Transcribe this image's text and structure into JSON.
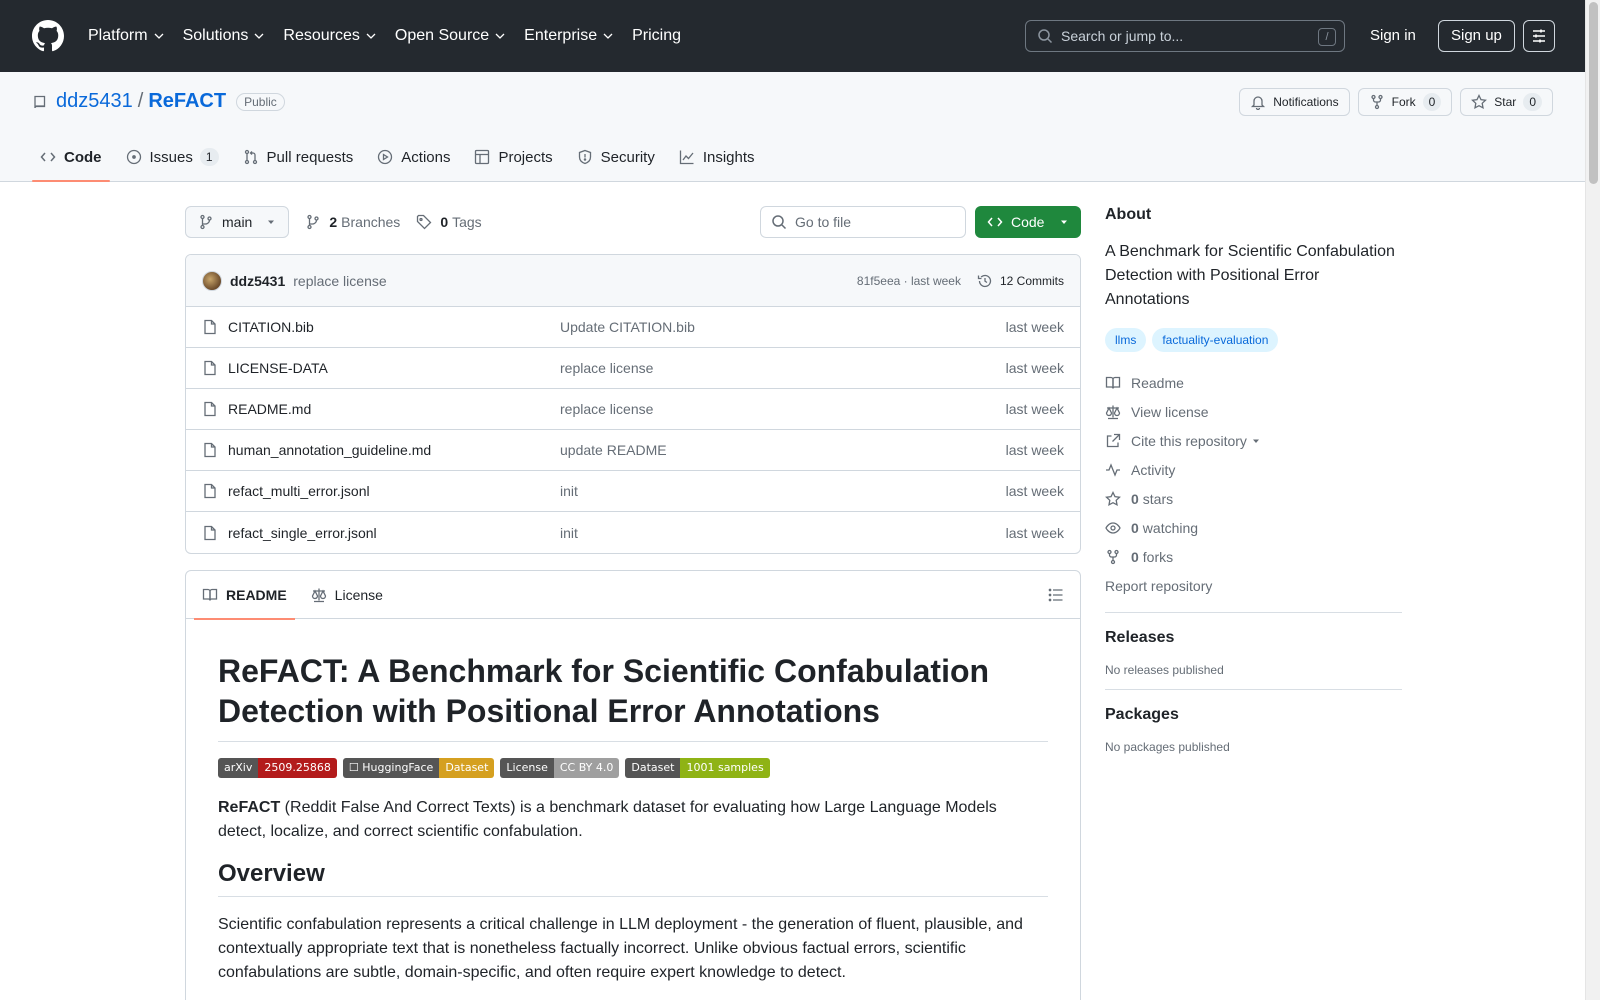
{
  "header": {
    "nav": [
      "Platform",
      "Solutions",
      "Resources",
      "Open Source",
      "Enterprise",
      "Pricing"
    ],
    "search_placeholder": "Search or jump to...",
    "search_key": "/",
    "signin": "Sign in",
    "signup": "Sign up"
  },
  "repo": {
    "owner": "ddz5431",
    "sep": "/",
    "name": "ReFACT",
    "visibility": "Public",
    "notifications": "Notifications",
    "fork": "Fork",
    "fork_count": "0",
    "star": "Star",
    "star_count": "0",
    "tabs": [
      {
        "label": "Code",
        "icon": "code-icon"
      },
      {
        "label": "Issues",
        "icon": "issue-icon",
        "count": "1"
      },
      {
        "label": "Pull requests",
        "icon": "pull-request-icon"
      },
      {
        "label": "Actions",
        "icon": "play-icon"
      },
      {
        "label": "Projects",
        "icon": "table-icon"
      },
      {
        "label": "Security",
        "icon": "shield-icon"
      },
      {
        "label": "Insights",
        "icon": "graph-icon"
      }
    ]
  },
  "toolbar": {
    "branch": "main",
    "branches_count": "2",
    "branches_label": "Branches",
    "tags_count": "0",
    "tags_label": "Tags",
    "goto_placeholder": "Go to file",
    "code_label": "Code"
  },
  "latest_commit": {
    "author": "ddz5431",
    "message": "replace license",
    "meta": "81f5eea · last week",
    "commits": "12 Commits"
  },
  "files": [
    {
      "name": "CITATION.bib",
      "message": "Update CITATION.bib",
      "date": "last week"
    },
    {
      "name": "LICENSE-DATA",
      "message": "replace license",
      "date": "last week"
    },
    {
      "name": "README.md",
      "message": "replace license",
      "date": "last week"
    },
    {
      "name": "human_annotation_guideline.md",
      "message": "update README",
      "date": "last week"
    },
    {
      "name": "refact_multi_error.jsonl",
      "message": "init",
      "date": "last week"
    },
    {
      "name": "refact_single_error.jsonl",
      "message": "init",
      "date": "last week"
    }
  ],
  "readme": {
    "tab_readme": "README",
    "tab_license": "License",
    "title": "ReFACT: A Benchmark for Scientific Confabulation Detection with Positional Error Annotations",
    "badges": [
      {
        "label": "arXiv",
        "value": "2509.25868",
        "color": "#b31b1b"
      },
      {
        "label": "☐ HuggingFace",
        "value": "Dataset",
        "color": "#d5a020"
      },
      {
        "label": "License",
        "value": "CC BY 4.0",
        "color": "#9f9f9f"
      },
      {
        "label": "Dataset",
        "value": "1001 samples",
        "color": "#8fb315"
      }
    ],
    "intro_bold": "ReFACT",
    "intro_rest": " (Reddit False And Correct Texts) is a benchmark dataset for evaluating how Large Language Models detect, localize, and correct scientific confabulation.",
    "overview_heading": "Overview",
    "overview_text": "Scientific confabulation represents a critical challenge in LLM deployment - the generation of fluent, plausible, and contextually appropriate text that is nonetheless factually incorrect. Unlike obvious factual errors, scientific confabulations are subtle, domain-specific, and often require expert knowledge to detect."
  },
  "sidebar": {
    "about_heading": "About",
    "description": "A Benchmark for Scientific Confabulation Detection with Positional Error Annotations",
    "topics": [
      "llms",
      "factuality-evaluation"
    ],
    "readme": "Readme",
    "license": "View license",
    "cite": "Cite this repository",
    "activity": "Activity",
    "stars_count": "0",
    "stars_label": "stars",
    "watching_count": "0",
    "watching_label": "watching",
    "forks_count": "0",
    "forks_label": "forks",
    "report": "Report repository",
    "releases_heading": "Releases",
    "releases_text": "No releases published",
    "packages_heading": "Packages",
    "packages_text": "No packages published"
  },
  "colors": {
    "header_bg": "#24292f",
    "link": "#0969da",
    "green": "#1f883d",
    "tab_underline": "#fd8c73"
  }
}
